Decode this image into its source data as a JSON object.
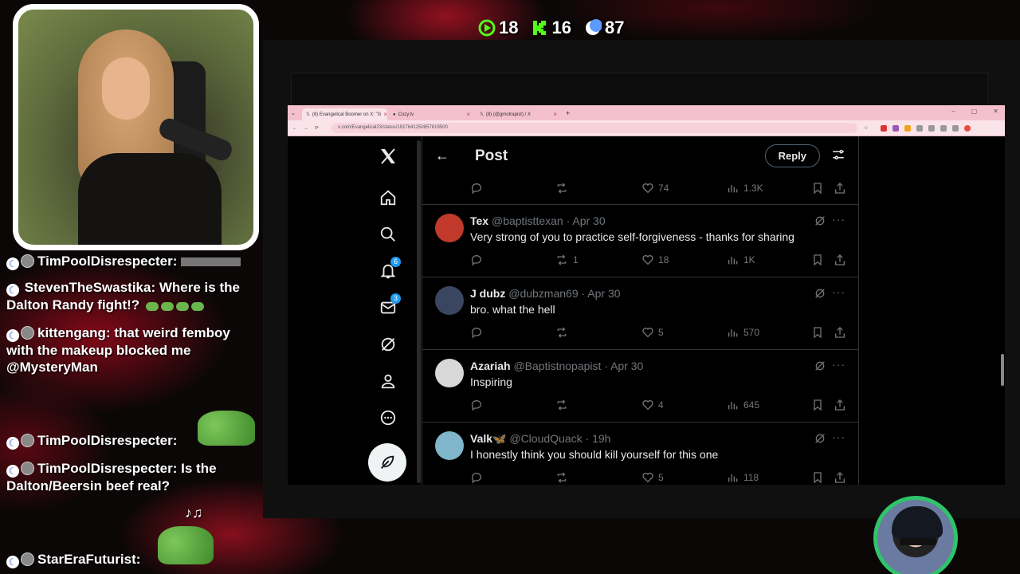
{
  "stream": {
    "stats": [
      {
        "icon": "play-icon",
        "value": "18",
        "color": "#53fc18"
      },
      {
        "icon": "kick-icon",
        "value": "16",
        "color": "#53fc18"
      },
      {
        "icon": "moon-icon",
        "value": "87",
        "color": "#5b9bff"
      }
    ],
    "chat": [
      {
        "user": "TimPoolDisrespecter:",
        "text": ""
      },
      {
        "user": "StevenTheSwastika:",
        "text": "Where is the Dalton Randy fight!?"
      },
      {
        "user": "kittengang:",
        "text": "that weird femboy with the makeup blocked me @MysteryMan"
      },
      {
        "user": "TimPoolDisrespecter:",
        "text": ""
      },
      {
        "user": "TimPoolDisrespecter:",
        "text": "Is the Dalton/Beersin beef real?"
      },
      {
        "user": "StarEraFuturist:",
        "text": ""
      }
    ]
  },
  "browser": {
    "tabs": [
      {
        "label": "(8) Evangelical Boomer on X: \"G",
        "active": true
      },
      {
        "label": "Cozy.tv",
        "active": false
      },
      {
        "label": "(8) (@gmotrapist) / X",
        "active": false
      }
    ],
    "url": "x.com/Evangelical23/status/1917641250857819500"
  },
  "x": {
    "nav": [
      {
        "name": "x-logo-icon"
      },
      {
        "name": "home-icon"
      },
      {
        "name": "search-icon"
      },
      {
        "name": "notifications-icon",
        "badge": "6"
      },
      {
        "name": "messages-icon",
        "badge": "3"
      },
      {
        "name": "grok-icon"
      },
      {
        "name": "profile-icon"
      },
      {
        "name": "more-icon"
      }
    ],
    "header": {
      "title": "Post",
      "reply_label": "Reply"
    },
    "top_actions": {
      "replies": "",
      "reposts": "",
      "likes": "74",
      "views": "1.3K"
    },
    "replies": [
      {
        "name": "Tex",
        "handle": "@baptisttexan",
        "date": "· Apr 30",
        "text": "Very strong of you to practice self-forgiveness - thanks for sharing",
        "replies": "",
        "reposts": "1",
        "likes": "18",
        "views": "1K",
        "avatar_color": "#c0392b"
      },
      {
        "name": "J dubz",
        "handle": "@dubzman69",
        "date": "· Apr 30",
        "text": "bro. what the hell",
        "replies": "",
        "reposts": "",
        "likes": "5",
        "views": "570",
        "avatar_color": "#3a4660"
      },
      {
        "name": "Azariah",
        "handle": "@Baptistnopapist",
        "date": "· Apr 30",
        "text": "Inspiring",
        "replies": "",
        "reposts": "",
        "likes": "4",
        "views": "645",
        "avatar_color": "#d8d8d8"
      },
      {
        "name": "Valk🦋",
        "handle": "@CloudQuack",
        "date": "· 19h",
        "text": "I honestly think you should kill yourself for this one",
        "replies": "",
        "reposts": "",
        "likes": "5",
        "views": "118",
        "avatar_color": "#7fb6c9"
      }
    ]
  }
}
